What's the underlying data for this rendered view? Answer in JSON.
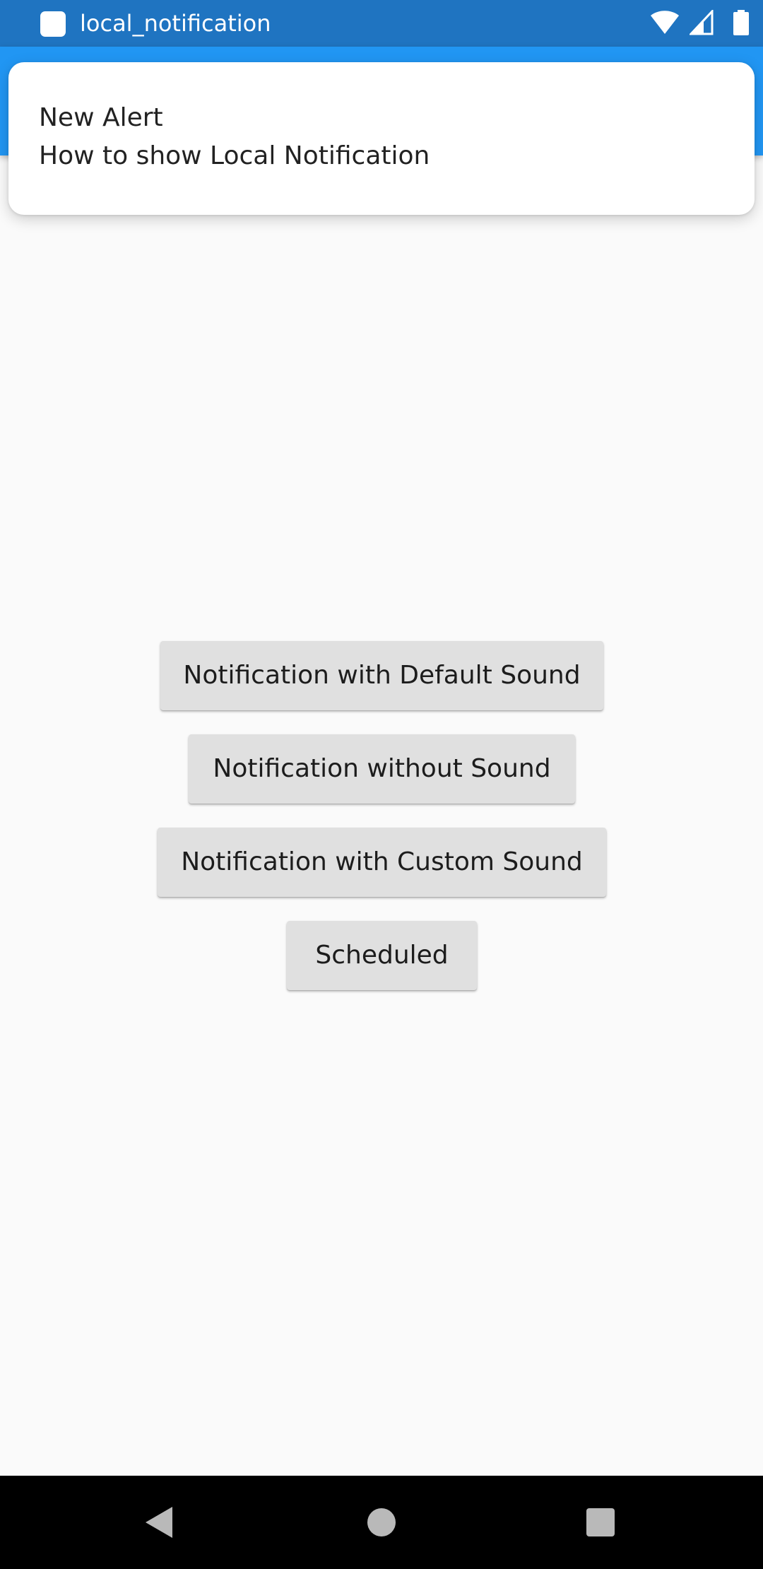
{
  "status_bar": {
    "app_name": "local_notification",
    "icons": [
      "app-icon",
      "wifi-icon",
      "signal-icon",
      "battery-icon"
    ],
    "color": "#1f74c1"
  },
  "app_bar": {
    "color": "#2196f3"
  },
  "notification": {
    "title": "New Alert",
    "text": "How to show Local Notification"
  },
  "buttons": [
    {
      "label": "Notification with Default Sound"
    },
    {
      "label": "Notification without Sound"
    },
    {
      "label": "Notification with Custom Sound"
    },
    {
      "label": "Scheduled"
    }
  ],
  "nav_bar": {
    "icons": [
      "back-icon",
      "home-icon",
      "recents-icon"
    ]
  }
}
